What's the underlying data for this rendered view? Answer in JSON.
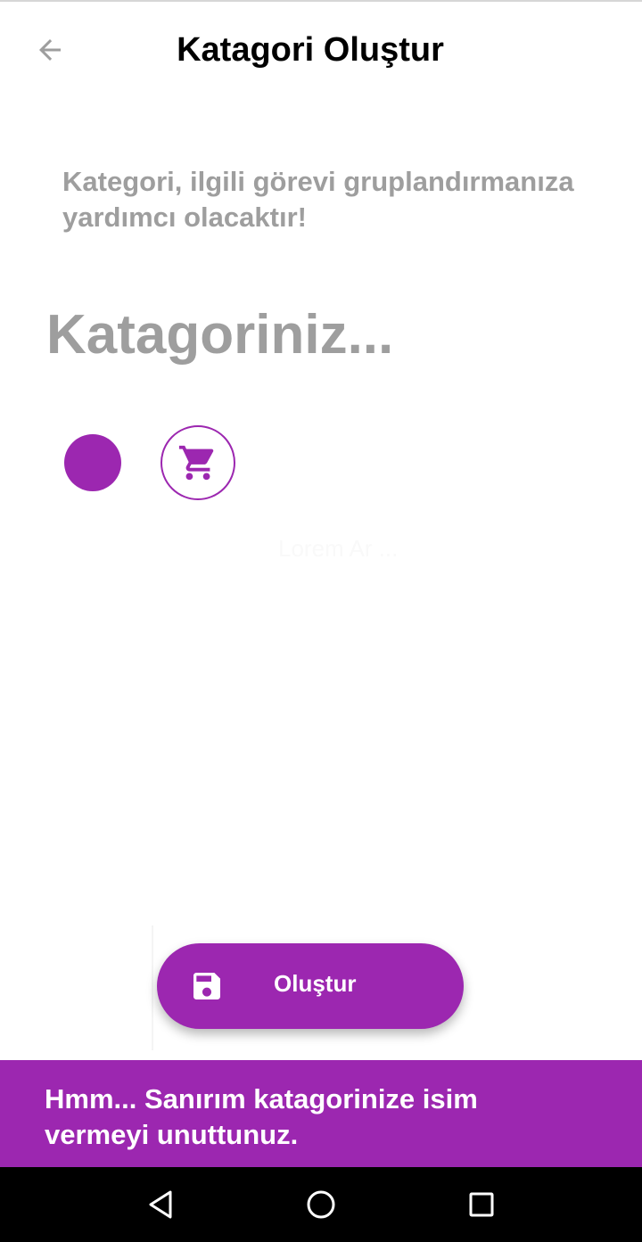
{
  "header": {
    "title": "Katagori Oluştur",
    "back_icon": "arrow-left-icon"
  },
  "description": "Kategori, ilgili görevi gruplandırmanıza yardımcı olacaktır!",
  "form": {
    "name_placeholder": "Katagoriniz...",
    "name_value": "",
    "selected_color": "#9c27b0",
    "selected_icon": "shopping-cart-icon"
  },
  "faint_text": "Lorem Ar ...",
  "fab": {
    "label": "Oluştur",
    "icon": "save-icon"
  },
  "snackbar": {
    "message": "Hmm... Sanırım katagorinize isim vermeyi unuttunuz."
  },
  "system_nav": {
    "back": "triangle-back-icon",
    "home": "circle-home-icon",
    "recents": "square-recents-icon"
  },
  "colors": {
    "accent": "#9c27b0",
    "muted_text": "#9e9e9e",
    "title": "#000000"
  }
}
